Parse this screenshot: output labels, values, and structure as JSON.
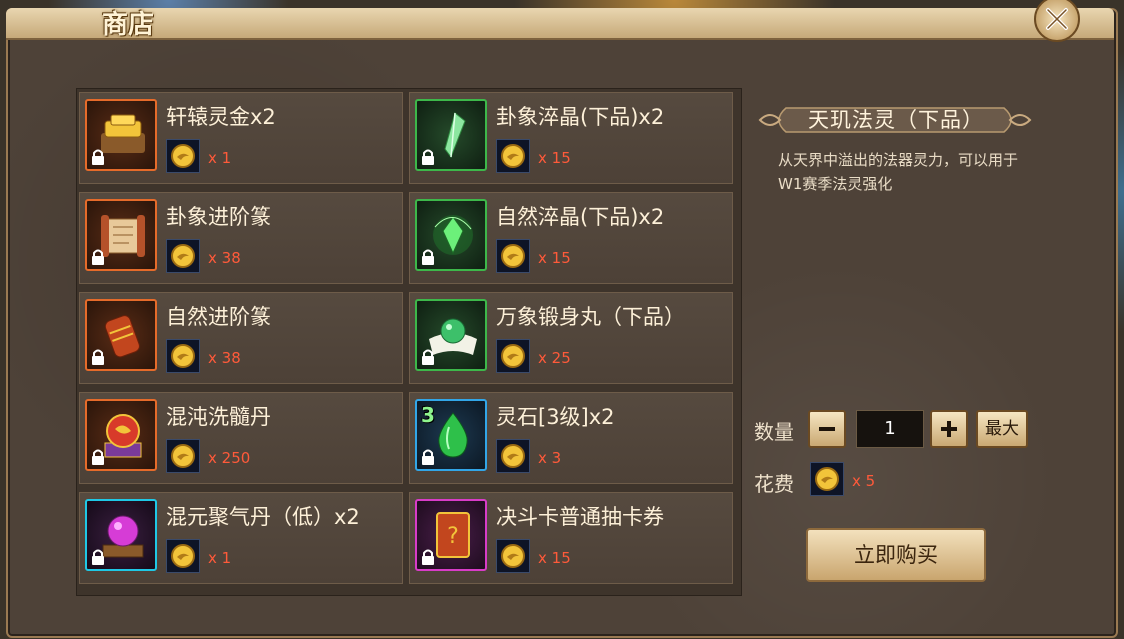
{
  "window": {
    "title": "商店"
  },
  "items": [
    {
      "name": "轩辕灵金x2",
      "price": "x 1",
      "quality": "orange",
      "icon": "gold-ingot-chest-icon"
    },
    {
      "name": "卦象淬晶(下品)x2",
      "price": "x 15",
      "quality": "green",
      "icon": "crystal-shard-icon"
    },
    {
      "name": "卦象进阶篆",
      "price": "x 38",
      "quality": "orange",
      "icon": "scroll-icon"
    },
    {
      "name": "自然淬晶(下品)x2",
      "price": "x 15",
      "quality": "green",
      "icon": "green-crystal-icon"
    },
    {
      "name": "自然进阶篆",
      "price": "x 38",
      "quality": "orange",
      "icon": "rolled-scroll-icon"
    },
    {
      "name": "万象锻身丸（下品）",
      "price": "x 25",
      "quality": "green",
      "icon": "jade-pill-icon"
    },
    {
      "name": "混沌洗髓丹",
      "price": "x 250",
      "quality": "orange",
      "icon": "chaos-orb-icon"
    },
    {
      "name": "灵石[3级]x2",
      "price": "x 3",
      "quality": "blue",
      "icon": "spirit-stone-icon",
      "level": "3"
    },
    {
      "name": "混元聚气丹（低）x2",
      "price": "x 1",
      "quality": "cyan",
      "icon": "purple-orb-icon"
    },
    {
      "name": "决斗卡普通抽卡券",
      "price": "x 15",
      "quality": "purple",
      "icon": "card-ticket-icon"
    }
  ],
  "detail": {
    "title": "天玑法灵（下品）",
    "description": "从天界中溢出的法器灵力，可以用于W1赛季法灵强化"
  },
  "purchase": {
    "quantity_label": "数量",
    "quantity": "1",
    "max_label": "最大",
    "cost_label": "花费",
    "cost": "x 5",
    "buy_label": "立即购买"
  },
  "colors": {
    "price": "#ff5a3a",
    "panel": "#4e4238",
    "accent": "#c6a979"
  }
}
